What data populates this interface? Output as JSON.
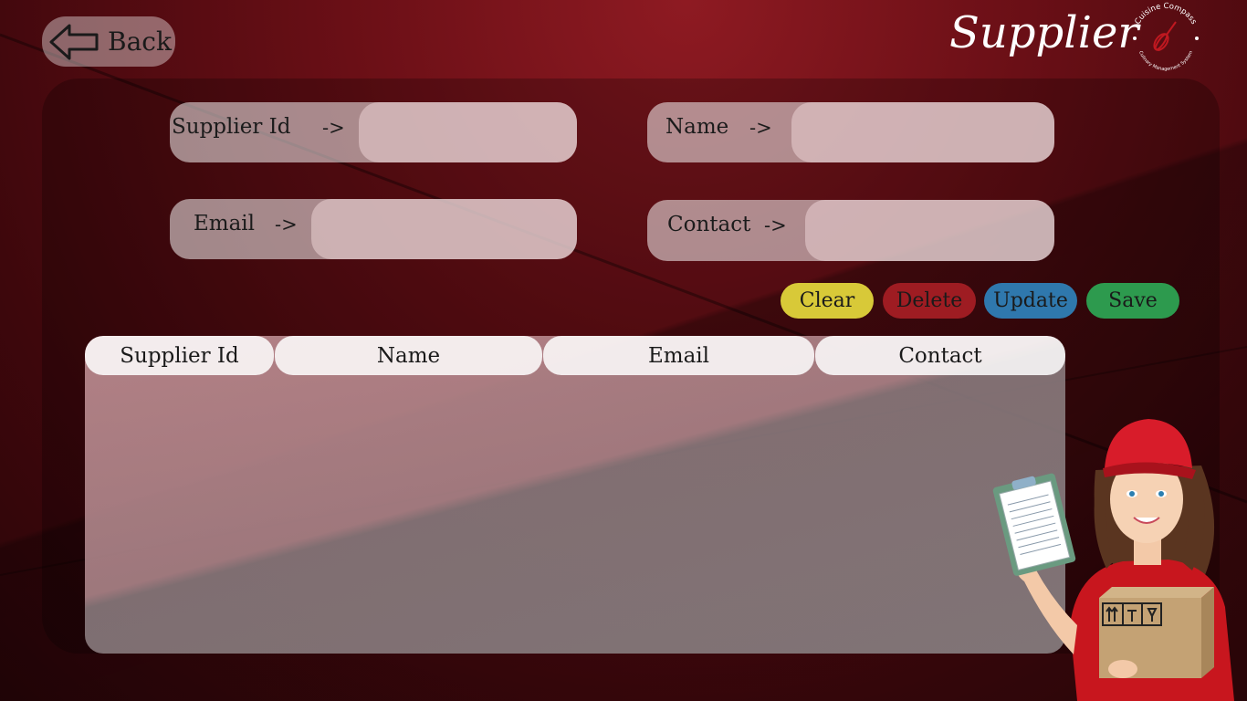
{
  "header": {
    "back_label": "Back",
    "title": "Supplier",
    "logo_top_text": "Cuisine Compass",
    "logo_bottom_text": "Culinary Management System"
  },
  "form": {
    "supplier_id": {
      "label": "Supplier Id",
      "arrow": "->",
      "value": ""
    },
    "name": {
      "label": "Name",
      "arrow": "->",
      "value": ""
    },
    "email": {
      "label": "Email",
      "arrow": "->",
      "value": ""
    },
    "contact": {
      "label": "Contact",
      "arrow": "->",
      "value": ""
    }
  },
  "actions": {
    "clear": "Clear",
    "delete": "Delete",
    "update": "Update",
    "save": "Save"
  },
  "colors": {
    "clear": "#d8c938",
    "delete": "#9e1c22",
    "update": "#2f78ad",
    "save": "#2d9a4e"
  },
  "table": {
    "columns": [
      "Supplier Id",
      "Name",
      "Email",
      "Contact"
    ],
    "rows": []
  },
  "icons": {
    "back": "left-arrow-icon",
    "logo": "whisk-icon",
    "illustration": "delivery-woman-illustration"
  }
}
